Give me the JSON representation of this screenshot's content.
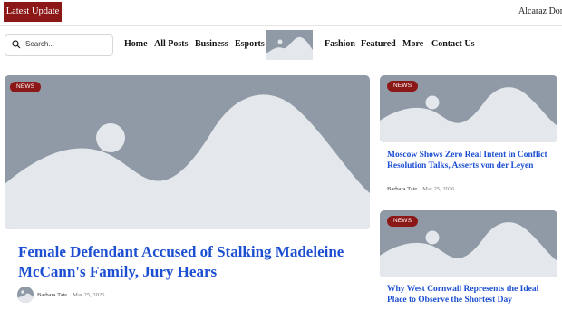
{
  "ticker": {
    "badge_label": "Latest Update",
    "headline": "Alcaraz Dominates"
  },
  "search": {
    "placeholder": "Search..."
  },
  "nav": {
    "items": [
      "Home",
      "All Posts",
      "Business",
      "Esports",
      "Fashion",
      "Featured",
      "More",
      "Contact Us"
    ]
  },
  "featured": {
    "category": "NEWS",
    "title": "Female Defendant Accused of Stalking Madeleine McCann's Family, Jury Hears",
    "author": "Barbara Tate",
    "date": "Mar 25, 2026"
  },
  "side_articles": [
    {
      "category": "NEWS",
      "title": "Moscow Shows Zero Real Intent in Conflict Resolution Talks, Asserts von der Leyen",
      "author": "Barbara Tate",
      "date": "Mar 25, 2026"
    },
    {
      "category": "NEWS",
      "title": "Why West Cornwall Represents the Ideal Place to Observe the Shortest Day",
      "author": "",
      "date": ""
    }
  ],
  "colors": {
    "accent": "#8c1717",
    "link": "#1c4fd1",
    "placeholder_bg": "#8f9aa6",
    "placeholder_fg": "#e4e7eb"
  }
}
